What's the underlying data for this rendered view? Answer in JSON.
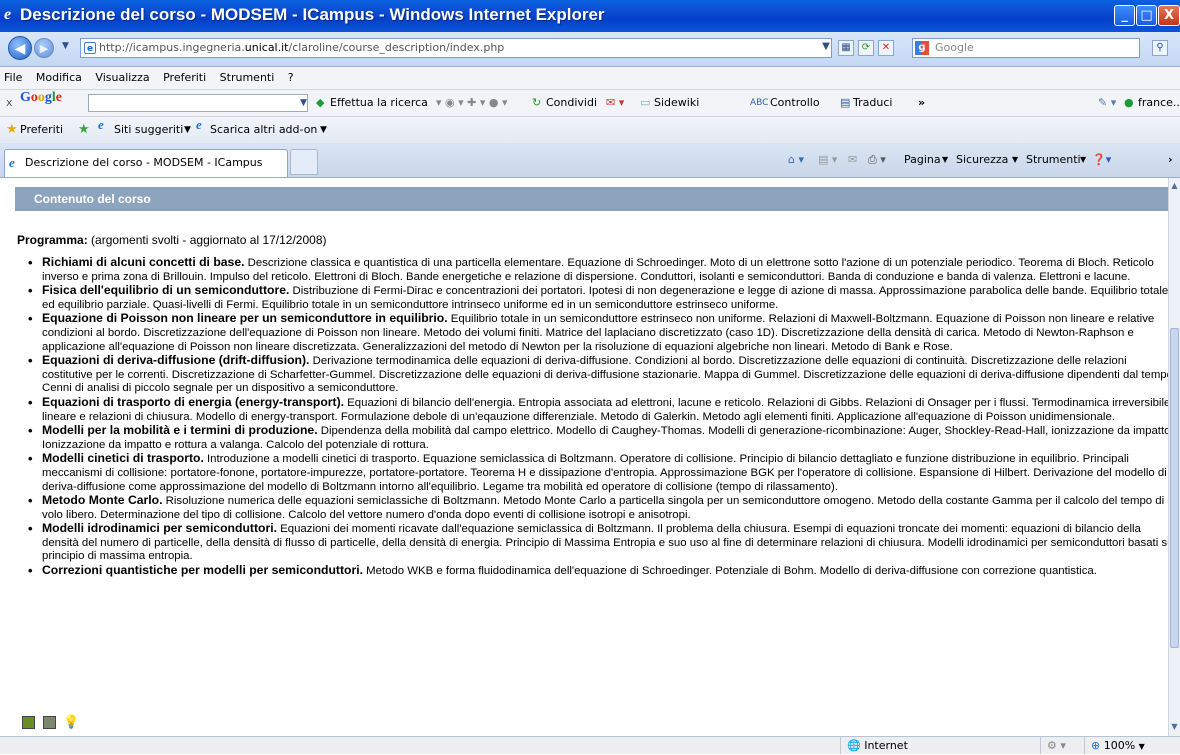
{
  "window": {
    "title": "Descrizione del corso - MODSEM - ICampus - Windows Internet Explorer",
    "minimize": "_",
    "maximize": "□",
    "close": "X"
  },
  "address": {
    "url_prefix": "http://icampus.ingegneria.",
    "url_host": "unical.it",
    "url_path": "/claroline/course_description/index.php",
    "search_placeholder": "Google"
  },
  "menu": [
    "File",
    "Modifica",
    "Visualizza",
    "Preferiti",
    "Strumenti",
    "?"
  ],
  "google_toolbar": {
    "close": "x",
    "search_button": "Effettua la ricerca",
    "share": "Condividi",
    "sidewiki": "Sidewiki",
    "spell": "Controllo",
    "translate": "Traduci",
    "more": "»",
    "user": "france..."
  },
  "favorites": {
    "label": "Preferiti",
    "suggested": "Siti suggeriti",
    "addons": "Scarica altri add-on"
  },
  "tab": {
    "title": "Descrizione del corso - MODSEM - ICampus"
  },
  "commands": {
    "page": "Pagina",
    "security": "Sicurezza",
    "tools": "Strumenti"
  },
  "content": {
    "section_title": "Contenuto del corso",
    "program_label": "Programma:",
    "program_note": " (argomenti svolti - aggiornato al 17/12/2008)",
    "topics": [
      {
        "title": "Richiami di alcuni concetti di base.",
        "text": " Descrizione classica e quantistica di una particella elementare. Equazione di Schroedinger. Moto di un elettrone sotto l'azione di un potenziale periodico. Teorema di Bloch. Reticolo inverso e prima zona di Brillouin. Impulso del reticolo. Elettroni di Bloch. Bande energetiche e relazione di dispersione. Conduttori, isolanti e semiconduttori. Banda di conduzione e banda di valenza. Elettroni e lacune."
      },
      {
        "title": "Fisica dell'equilibrio di un semiconduttore.",
        "text": " Distribuzione di Fermi-Dirac e concentrazioni dei portatori. Ipotesi di non degenerazione e legge di azione di massa. Approssimazione parabolica delle bande. Equilibrio totale ed equilibrio parziale. Quasi-livelli di Fermi. Equilibrio totale in un semiconduttore intrinseco uniforme ed in un semiconduttore estrinseco uniforme."
      },
      {
        "title": "Equazione di Poisson non lineare per un semiconduttore in equilibrio.",
        "text": " Equilibrio totale in un semiconduttore estrinseco non uniforme. Relazioni di Maxwell-Boltzmann. Equazione di Poisson non lineare e relative condizioni al bordo. Discretizzazione dell'equazione di Poisson non lineare. Metodo dei volumi finiti. Matrice del laplaciano discretizzato (caso 1D). Discretizzazione della densità di carica. Metodo di Newton-Raphson e applicazione all'equazione di Poisson non lineare discretizzata. Generalizzazioni del metodo di Newton per la risoluzione di equazioni algebriche non lineari. Metodo di Bank e Rose."
      },
      {
        "title": "Equazioni di deriva-diffusione (drift-diffusion).",
        "text": " Derivazione termodinamica delle equazioni di deriva-diffusione. Condizioni al bordo. Discretizzazione delle equazioni di continuità. Discretizzazione delle relazioni costitutive per le correnti. Discretizzazione di Scharfetter-Gummel. Discretizzazione delle equazioni di deriva-diffusione stazionarie. Mappa di Gummel. Discretizzazione delle equazioni di deriva-diffusione dipendenti dal tempo. Cenni di analisi di piccolo segnale per un dispositivo a semiconduttore."
      },
      {
        "title": "Equazioni di trasporto di energia (energy-transport).",
        "text": " Equazioni di bilancio dell'energia. Entropia associata ad elettroni, lacune e reticolo. Relazioni di Gibbs. Relazioni di Onsager per i flussi. Termodinamica irreversibile lineare e relazioni di chiusura. Modello di energy-transport. Formulazione debole di un'eqauzione differenziale. Metodo di Galerkin. Metodo agli elementi finiti. Applicazione all'equazione di Poisson unidimensionale."
      },
      {
        "title": "Modelli per la mobilità e i termini di produzione.",
        "text": " Dipendenza della mobilità dal campo elettrico. Modello di Caughey-Thomas. Modelli di generazione-ricombinazione: Auger, Shockley-Read-Hall, ionizzazione da impatto. Ionizzazione da impatto e rottura a valanga. Calcolo del potenziale di rottura."
      },
      {
        "title": "Modelli cinetici di trasporto.",
        "text": " Introduzione a modelli cinetici di trasporto. Equazione semiclassica di Boltzmann. Operatore di collisione. Principio di bilancio dettagliato e funzione distribuzione in equilibrio. Principali meccanismi di collisione: portatore-fonone, portatore-impurezze, portatore-portatore. Teorema H e dissipazione d'entropia. Approssimazione BGK per l'operatore di collisione. Espansione di Hilbert. Derivazione del modello di deriva-diffusione come approssimazione del modello di Boltzmann intorno all'equilibrio. Legame tra mobilità ed operatore di collisione (tempo di rilassamento)."
      },
      {
        "title": "Metodo Monte Carlo.",
        "text": " Risoluzione numerica delle equazioni semiclassiche di Boltzmann. Metodo Monte Carlo a particella singola per un semiconduttore omogeno. Metodo della costante Gamma per il calcolo del tempo di volo libero. Determinazione del tipo di collisione. Calcolo del vettore numero d'onda dopo eventi di collisione isotropi e anisotropi."
      },
      {
        "title": "Modelli idrodinamici per semiconduttori.",
        "text": " Equazioni dei momenti ricavate dall'equazione semiclassica di Boltzmann. Il problema della chiusura. Esempi di equazioni troncate dei momenti: equazioni di bilancio della densità del numero di particelle, della densità di flusso di particelle, della densità di energia. Principio di Massima Entropia e suo uso al fine di determinare relazioni di chiusura. Modelli idrodinamici per semiconduttori basati sul principio di massima entropia."
      },
      {
        "title": "Correzioni quantistiche per modelli per semiconduttori.",
        "text": " Metodo WKB e forma fluidodinamica dell'equazione di Schroedinger. Potenziale di Bohm. Modello di deriva-diffusione con correzione quantistica."
      }
    ]
  },
  "status": {
    "zone": "Internet",
    "zoom": "100%"
  }
}
